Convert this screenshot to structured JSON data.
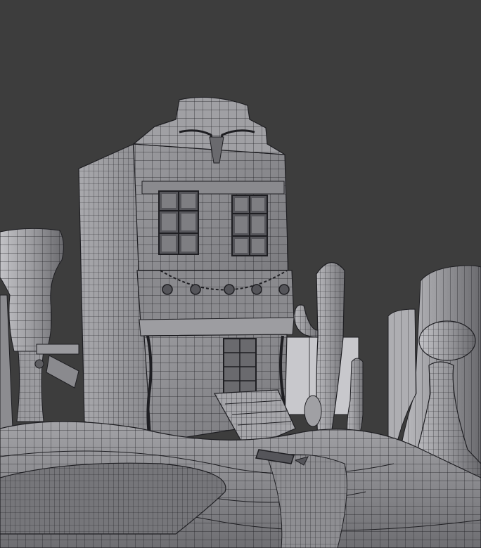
{
  "viewport": {
    "background_color": "#3d3d3d",
    "mesh_fill_color": "#8f8f93",
    "mesh_light_color": "#b4b4b8",
    "mesh_dark_color": "#5e5e62",
    "wire_color": "#1e1e22",
    "shading": "solid-wireframe"
  }
}
